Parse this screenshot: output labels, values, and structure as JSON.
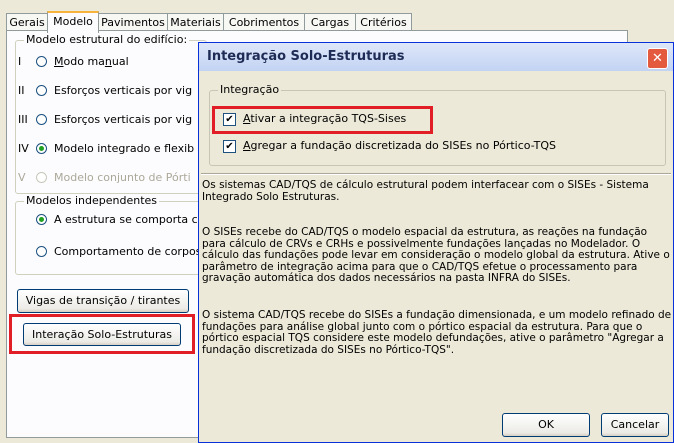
{
  "tabs": [
    {
      "label": "Gerais",
      "active": false
    },
    {
      "label": "Modelo",
      "active": true
    },
    {
      "label": "Pavimentos",
      "active": false
    },
    {
      "label": "Materiais",
      "active": false
    },
    {
      "label": "Cobrimentos",
      "active": false
    },
    {
      "label": "Cargas",
      "active": false
    },
    {
      "label": "Critérios",
      "active": false
    }
  ],
  "modelo_estrutural": {
    "title": "Modelo estrutural do edifício:",
    "options": [
      {
        "roman": "I",
        "label": "Modo manual",
        "selected": false,
        "enabled": true
      },
      {
        "roman": "II",
        "label": "Esforços verticais por vig",
        "selected": false,
        "enabled": true
      },
      {
        "roman": "III",
        "label": "Esforços verticais por vig",
        "selected": false,
        "enabled": true
      },
      {
        "roman": "IV",
        "label": "Modelo integrado e flexib",
        "selected": true,
        "enabled": true
      },
      {
        "roman": "V",
        "label": "Modelo conjunto de Pórti",
        "selected": false,
        "enabled": false
      }
    ]
  },
  "modelos_independentes": {
    "title": "Modelos independentes",
    "options": [
      {
        "label": "A estrutura se comporta cc",
        "selected": true
      },
      {
        "label": "Comportamento de corpos",
        "selected": false
      }
    ]
  },
  "buttons": {
    "vigas": "Vigas de transição / tirantes",
    "interacao": "Interação Solo-Estruturas"
  },
  "dialog": {
    "title": "Integração Solo-Estruturas",
    "close_glyph": "✕",
    "group_title": "Integração",
    "check1": {
      "label": "Ativar a integração TQS-Sises",
      "checked": true
    },
    "check2": {
      "label": "Agregar a fundação discretizada do SISEs no Pórtico-TQS",
      "checked": true
    },
    "paragraphs": [
      "Os sistemas CAD/TQS de cálculo estrutural podem interfacear com o SISEs - Sistema Integrado Solo Estruturas.",
      "O SISEs recebe do CAD/TQS o modelo espacial da estrutura, as reações na fundação para cálculo de CRVs e CRHs e possivelmente fundações lançadas no Modelador. O cálculo das fundações pode levar em consideração o modelo global da estrutura. Ative o parâmetro de integração acima para que o CAD/TQS efetue o processamento para gravação automática dos dados necessários na pasta INFRA do SISEs.",
      "O sistema CAD/TQS recebe do SISEs a fundação dimensionada, e um modelo refinado de fundações para análise global junto com o pórtico espacial da estrutura. Para que o pórtico espacial TQS considere este modelo defundações, ative o parâmetro \"Agregar a fundação discretizada do SISEs no Pórtico-TQS\"."
    ],
    "ok_label": "OK",
    "cancel_label": "Cancelar"
  },
  "colors": {
    "highlight": "#e11d25",
    "title_text": "#1e2b55",
    "close_bg": "#e35a3f",
    "radio_dot": "#21a121"
  }
}
